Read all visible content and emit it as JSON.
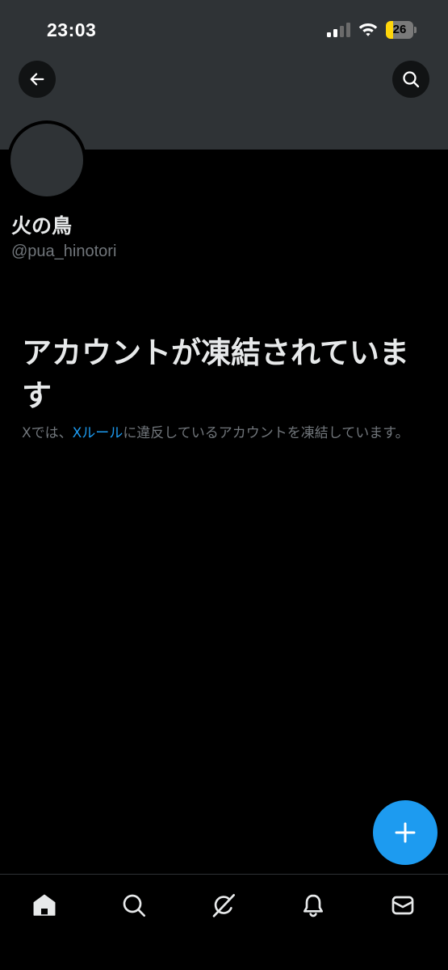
{
  "status_bar": {
    "time": "23:03",
    "battery_level": "26",
    "battery_fraction": 0.26,
    "signal_icon": "cellular-signal-icon",
    "wifi_icon": "wifi-icon"
  },
  "header": {
    "back_icon": "arrow-left-icon",
    "search_icon": "search-icon"
  },
  "profile": {
    "display_name": "火の鳥",
    "handle": "@pua_hinotori"
  },
  "suspension": {
    "title": "アカウントが凍結されています",
    "description_prefix": "Xでは、",
    "rules_link": "Xルール",
    "description_suffix": "に違反しているアカウントを凍結しています。"
  },
  "fab": {
    "icon": "plus-icon"
  },
  "bottom_nav": {
    "items": [
      {
        "icon": "home-icon",
        "active": true
      },
      {
        "icon": "search-icon",
        "active": false
      },
      {
        "icon": "grok-icon",
        "active": false
      },
      {
        "icon": "bell-icon",
        "active": false
      },
      {
        "icon": "mail-icon",
        "active": false
      }
    ]
  },
  "colors": {
    "background": "#000000",
    "banner": "#2f3336",
    "text_primary": "#e7e9ea",
    "text_secondary": "#71767b",
    "accent": "#1d9bf0",
    "battery": "#ffd60a"
  }
}
